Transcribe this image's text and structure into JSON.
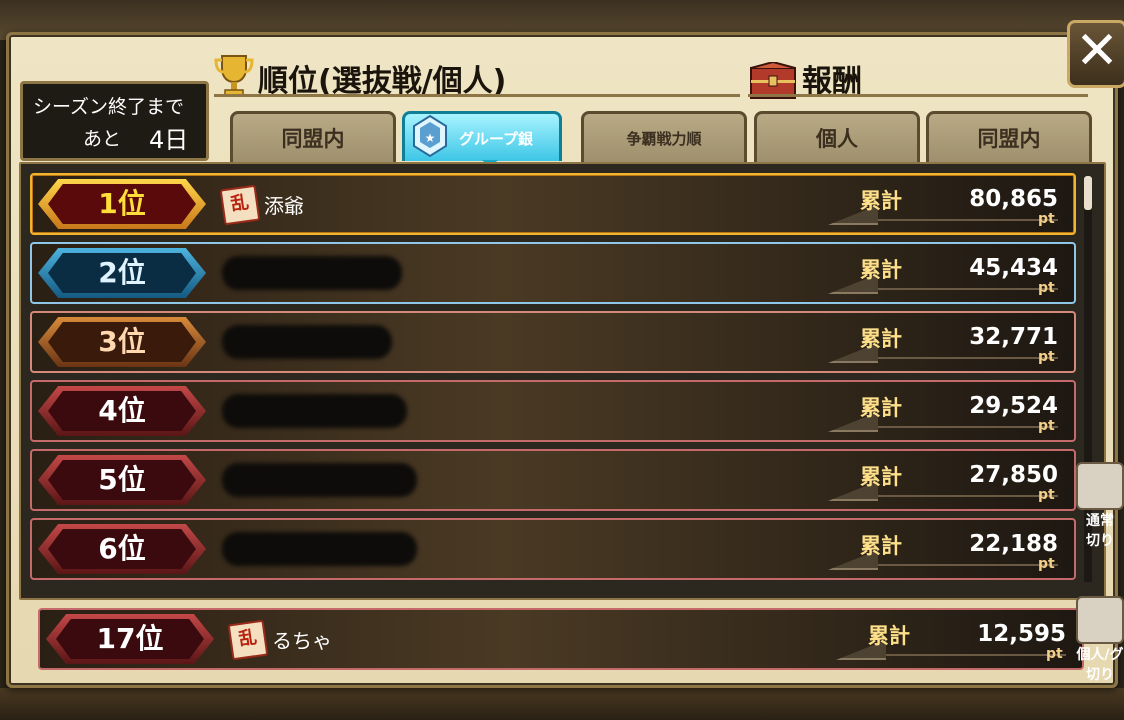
{
  "season": {
    "line1": "シーズン終了まで",
    "line2_prefix": "あと",
    "line2_days": "4日"
  },
  "headings": {
    "ranking": "順位(選抜戦/個人)",
    "rewards": "報酬"
  },
  "tabs": [
    {
      "label": "同盟内",
      "active": false
    },
    {
      "label": "グループ銀",
      "active": true
    },
    {
      "label": "争覇戦力順",
      "active": false
    },
    {
      "label": "個人",
      "active": false
    },
    {
      "label": "同盟内",
      "active": false
    }
  ],
  "close_label": "✕",
  "total_label": "累計",
  "score_unit": "pt",
  "rows": [
    {
      "rank": "1位",
      "tier": "gold",
      "guild_icon": "乱",
      "name": "添爺",
      "score": "80,865"
    },
    {
      "rank": "2位",
      "tier": "silver",
      "guild_icon": "",
      "name": "",
      "score": "45,434"
    },
    {
      "rank": "3位",
      "tier": "bronze",
      "guild_icon": "",
      "name": "",
      "score": "32,771"
    },
    {
      "rank": "4位",
      "tier": "red",
      "guild_icon": "",
      "name": "",
      "score": "29,524"
    },
    {
      "rank": "5位",
      "tier": "red",
      "guild_icon": "",
      "name": "",
      "score": "27,850"
    },
    {
      "rank": "6位",
      "tier": "red",
      "guild_icon": "",
      "name": "",
      "score": "22,188"
    }
  ],
  "my_row": {
    "rank": "17位",
    "guild_icon": "乱",
    "name": "るちゃ",
    "score": "12,595"
  },
  "side_buttons": [
    {
      "label_line1": "通常",
      "label_line2": "切り"
    },
    {
      "label_line1": "個人/グ",
      "label_line2": "切り"
    }
  ]
}
